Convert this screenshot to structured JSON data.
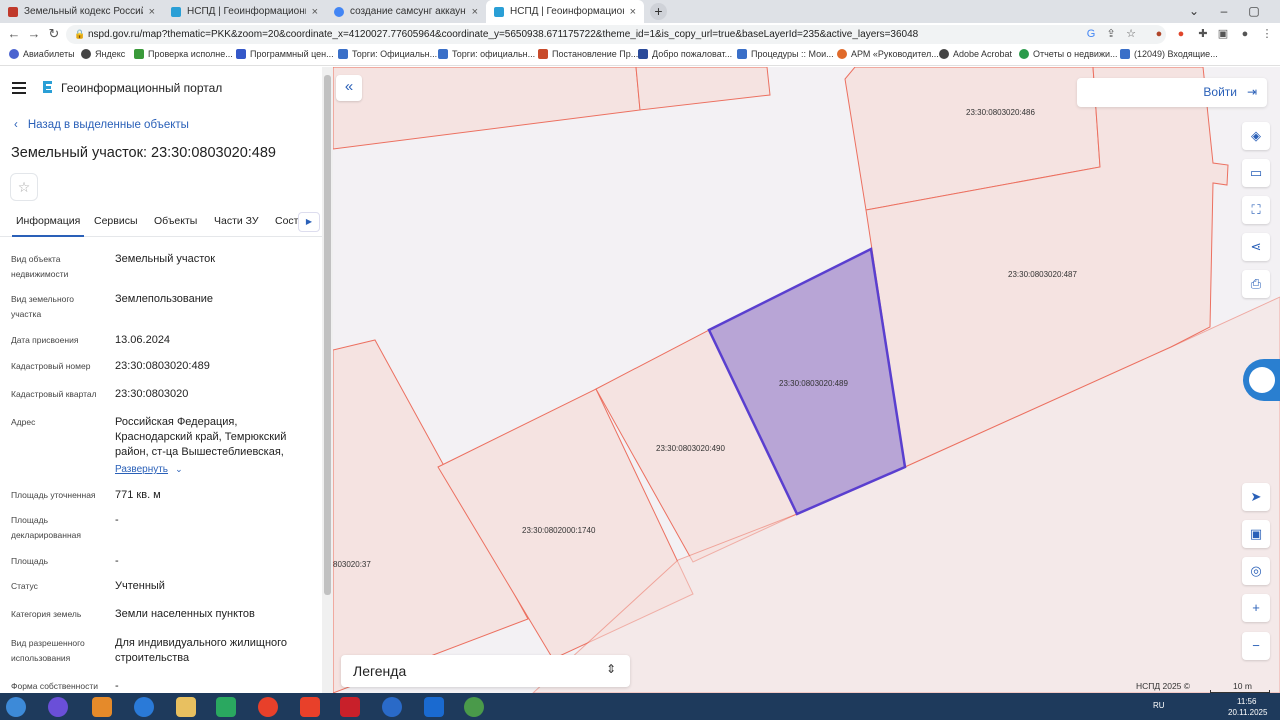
{
  "browser": {
    "tabs": [
      {
        "title": "Земельный кодекс Российской",
        "active": false
      },
      {
        "title": "НСПД | Геоинформационный п",
        "active": false
      },
      {
        "title": "создание самсунг аккаунта при",
        "active": false
      },
      {
        "title": "НСПД | Геоинформационный п",
        "active": true
      }
    ],
    "url": "nspd.gov.ru/map?thematic=PKK&zoom=20&coordinate_x=4120027.77605964&coordinate_y=5650938.671175722&theme_id=1&is_copy_url=true&baseLayerId=235&active_layers=36048",
    "bookmarks": [
      "Авиабилеты",
      "Яндекс",
      "Проверка исполне...",
      "Программный цен...",
      "Торги: Официальн...",
      "Торги: официальн...",
      "Постановление Пр...",
      "Добро пожаловат...",
      "Процедуры :: Мои...",
      "АРМ «Руководител...",
      "Adobe Acrobat",
      "Отчеты о недвижи...",
      "(12049) Входящие..."
    ]
  },
  "panel": {
    "portal_title": "Геоинформационный портал",
    "back_link": "Назад в выделенные объекты",
    "object_title": "Земельный участок: 23:30:0803020:489",
    "tabs": [
      "Информация",
      "Сервисы",
      "Объекты",
      "Части ЗУ",
      "Соста"
    ],
    "properties": [
      {
        "label": "Вид объекта недвижимости",
        "value": "Земельный участок"
      },
      {
        "label": "Вид земельного участка",
        "value": "Землепользование"
      },
      {
        "label": "Дата присвоения",
        "value": "13.06.2024"
      },
      {
        "label": "Кадастровый номер",
        "value": "23:30:0803020:489"
      },
      {
        "label": "Кадастровый квартал",
        "value": "23:30:0803020"
      },
      {
        "label": "Адрес",
        "value": "Российская Федерация, Краснодарский край, Темрюкский район, ст-ца Вышестеблиевская,"
      },
      {
        "label": "Площадь уточненная",
        "value": "771 кв. м"
      },
      {
        "label": "Площадь декларированная",
        "value": "-"
      },
      {
        "label": "Площадь",
        "value": "-"
      },
      {
        "label": "Статус",
        "value": "Учтенный"
      },
      {
        "label": "Категория земель",
        "value": "Земли населенных пунктов"
      },
      {
        "label": "Вид разрешенного использования",
        "value": "Для индивидуального жилищного строительства"
      },
      {
        "label": "Форма собственности",
        "value": "-"
      }
    ],
    "expand_link": "Развернуть"
  },
  "map": {
    "login_label": "Войти",
    "legend_label": "Легенда",
    "copyright": "НСПД 2025 ©",
    "scale": "10 m",
    "parcels": [
      "23:30:0803020:486",
      "23:30:0803020:487",
      "23:30:0803020:489",
      "23:30:0803020:490",
      "23:30:0802000:1740",
      "803020:37"
    ],
    "colors": {
      "parcel_fill": "#f5e3e1",
      "parcel_stroke": "#ec7060",
      "selected_fill": "#b8a5d6",
      "selected_stroke": "#5a3fcf",
      "accent": "#2a60b8"
    }
  },
  "taskbar": {
    "lang": "RU",
    "time": "11:56",
    "date": "20.11.2025"
  }
}
